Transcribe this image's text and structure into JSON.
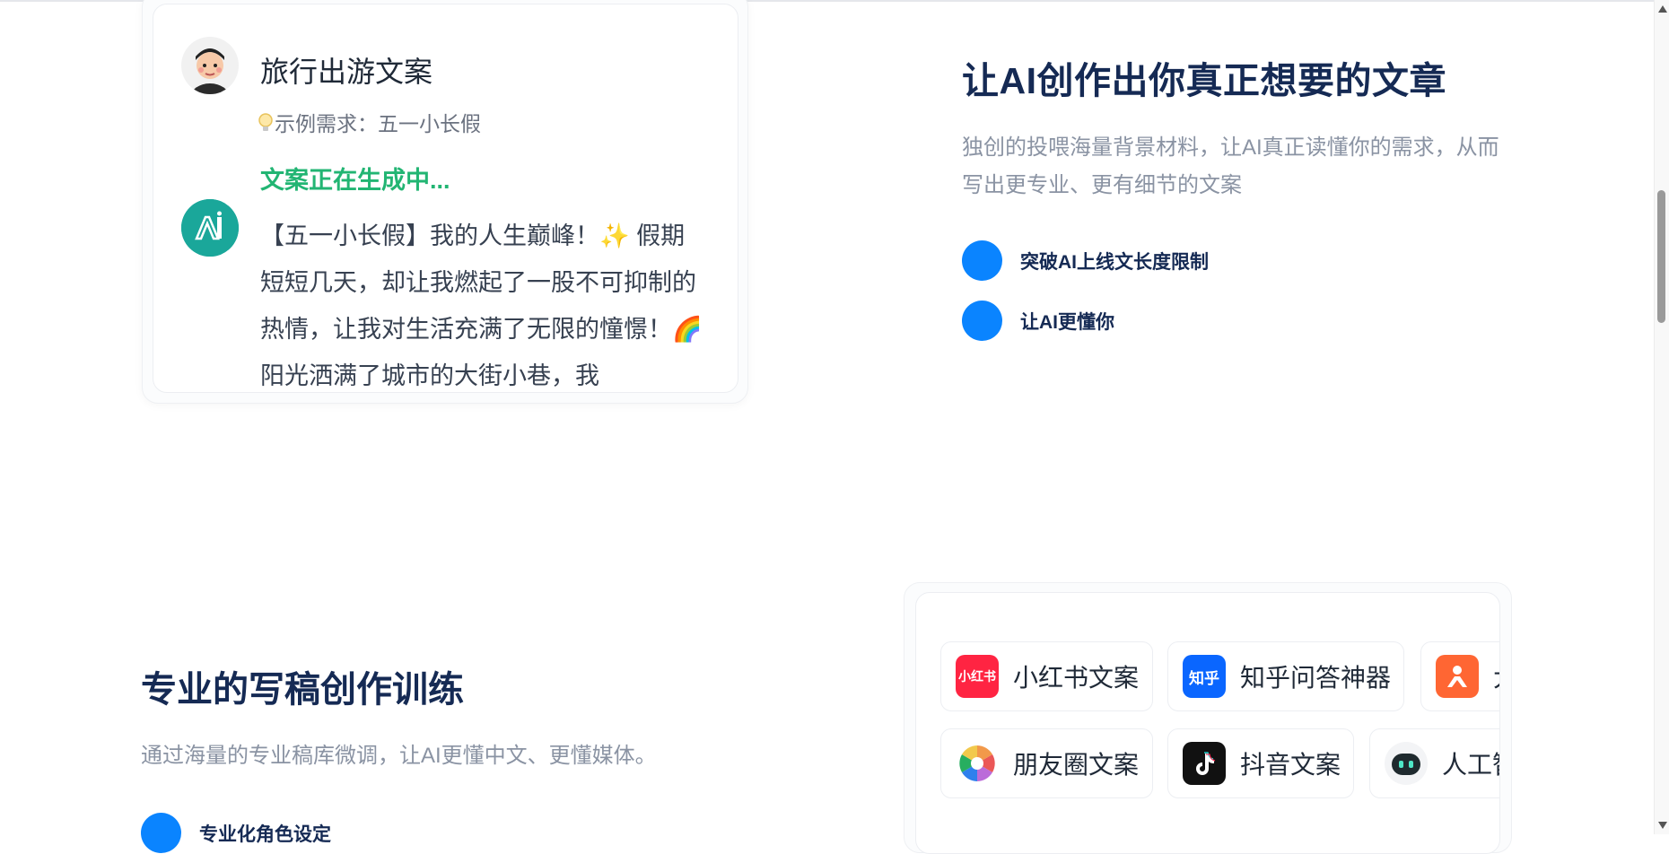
{
  "demo_card": {
    "title": "旅行出游文案",
    "example_request": "示例需求：五一小长假",
    "status": "文案正在生成中...",
    "generated_text": "【五一小长假】我的人生巅峰！✨ 假期短短几天，却让我燃起了一股不可抑制的热情，让我对生活充满了无限的憧憬！🌈 阳光洒满了城市的大街小巷，我"
  },
  "section_article": {
    "heading": "让AI创作出你真正想要的文章",
    "description": "独创的投喂海量背景材料，让AI真正读懂你的需求，从而写出更专业、更有细节的文案",
    "features": [
      "突破AI上线文长度限制",
      "让AI更懂你"
    ]
  },
  "section_training": {
    "heading": "专业的写稿创作训练",
    "description": "通过海量的专业稿库微调，让AI更懂中文、更懂媒体。",
    "features": [
      "专业化角色设定"
    ]
  },
  "templates": {
    "row1": [
      {
        "label": "小红书文案",
        "icon": "xiaohongshu-icon",
        "icon_text": "小红书",
        "color": "#ff2442"
      },
      {
        "label": "知乎问答神器",
        "icon": "zhihu-icon",
        "icon_text": "知乎",
        "color": "#0a66ff"
      },
      {
        "label": "大",
        "icon": "dianping-icon",
        "icon_text": "",
        "color": "#ff6633"
      }
    ],
    "row2": [
      {
        "label": "朋友圈文案",
        "icon": "moments-icon",
        "icon_text": "",
        "color": "#f2c94c"
      },
      {
        "label": "抖音文案",
        "icon": "douyin-icon",
        "icon_text": "",
        "color": "#111111"
      },
      {
        "label": "人工智",
        "icon": "robot-icon",
        "icon_text": "",
        "color": "#222222"
      }
    ]
  },
  "colors": {
    "accent": "#0a84ff",
    "heading": "#152a54",
    "generating": "#22b573",
    "ai_avatar": "#1aa79a"
  }
}
